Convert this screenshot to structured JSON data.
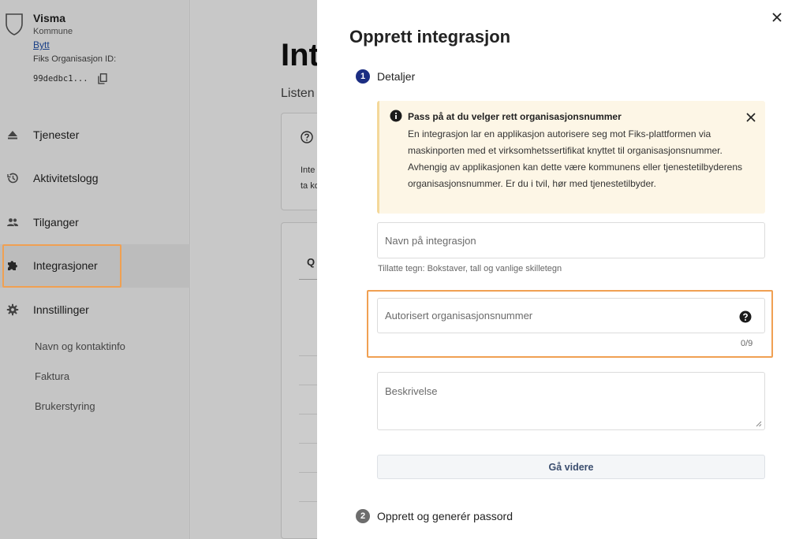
{
  "sidebar": {
    "org_name": "Visma",
    "org_type": "Kommune",
    "switch_label": "Bytt",
    "org_id_label": "Fiks Organisasjon ID:",
    "org_id_value": "99dedbc1...",
    "nav": [
      {
        "label": "Tjenester",
        "icon": "eject-icon"
      },
      {
        "label": "Aktivitetslogg",
        "icon": "history-icon"
      },
      {
        "label": "Tilganger",
        "icon": "people-icon"
      },
      {
        "label": "Integrasjoner",
        "icon": "puzzle-icon",
        "active": true
      },
      {
        "label": "Innstillinger",
        "icon": "gear-icon"
      }
    ],
    "settings_sub": [
      "Navn og kontaktinfo",
      "Faktura",
      "Brukerstyring"
    ]
  },
  "main": {
    "title_fragment": "Int",
    "desc_fragment": "Listen",
    "card_text_lines": [
      "Inte",
      "ta ko"
    ],
    "search_fragment": "Q"
  },
  "drawer": {
    "title": "Opprett integrasjon",
    "steps": [
      {
        "number": "1",
        "label": "Detaljer",
        "active": true
      },
      {
        "number": "2",
        "label": "Opprett og generér passord",
        "active": false
      }
    ],
    "alert": {
      "title": "Pass på at du velger rett organisasjonsnummer",
      "body": "En integrasjon lar en applikasjon autorisere seg mot Fiks-plattformen via maskinporten med et virksomhetssertifikat knyttet til organisasjonsnummer. Avhengig av applikasjonen kan dette være kommunens eller tjenestetilbyderens organisasjonsnummer. Er du i tvil, hør med tjenestetilbyder."
    },
    "name_field": {
      "placeholder": "Navn på integrasjon",
      "value": "",
      "hint": "Tillatte tegn: Bokstaver, tall og vanlige skilletegn"
    },
    "org_field": {
      "placeholder": "Autorisert organisasjonsnummer",
      "value": "",
      "counter": "0/9"
    },
    "description_field": {
      "placeholder": "Beskrivelse",
      "value": ""
    },
    "next_button": "Gå videre"
  },
  "colors": {
    "step_active": "#1b2d82",
    "step_inactive": "#6d6d6d",
    "highlight": "#f0a052",
    "alert_bg": "#fdf6e6",
    "link": "#1f4fa8"
  }
}
